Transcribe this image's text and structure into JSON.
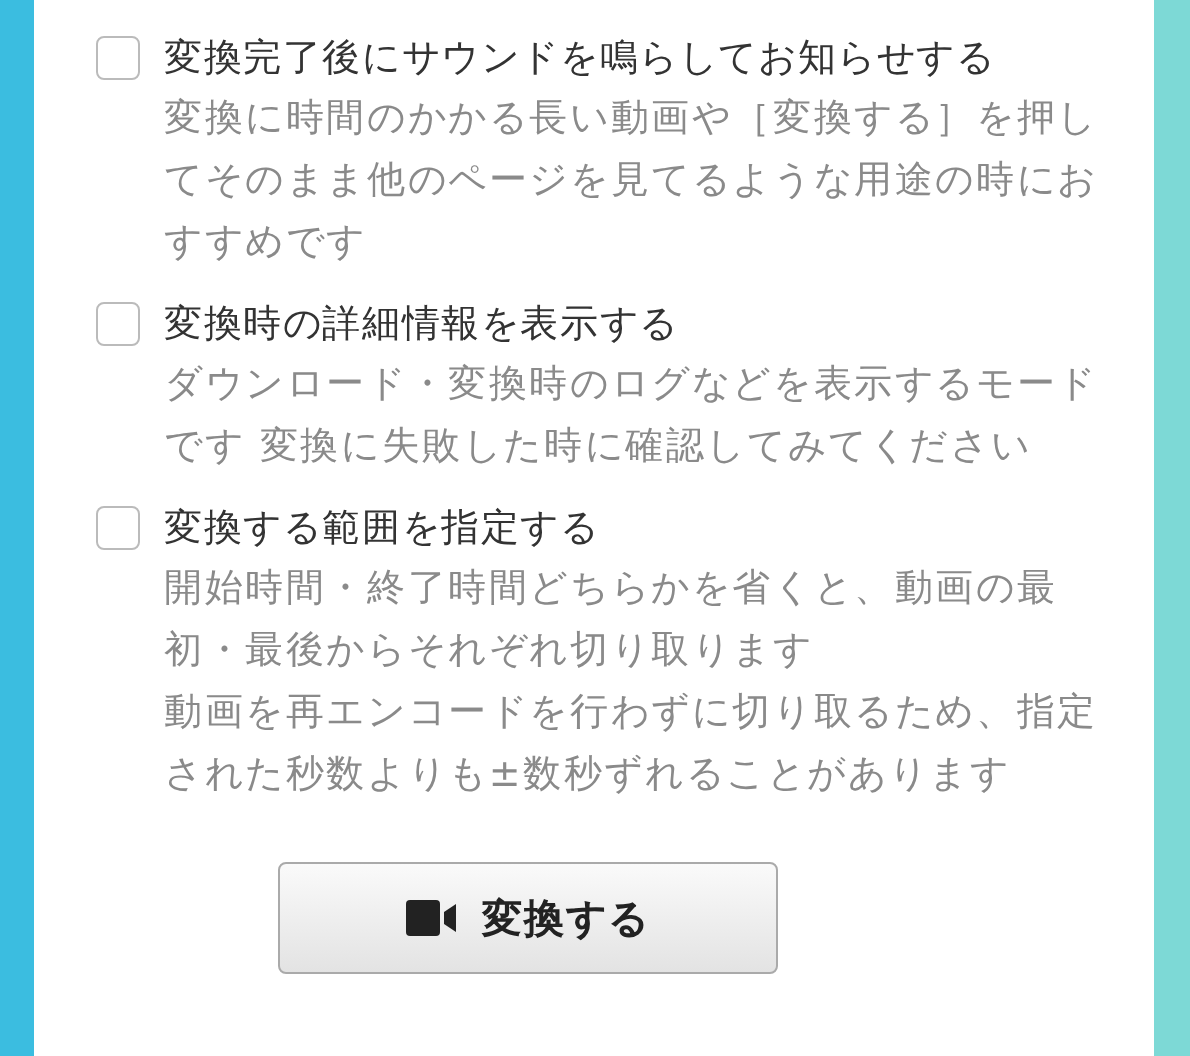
{
  "options": [
    {
      "label": "変換完了後にサウンドを鳴らしてお知らせする",
      "checked": false,
      "description": [
        "変換に時間のかかる長い動画や［変換する］を押してそのまま他のページを見てるような用途の時におすすめです"
      ]
    },
    {
      "label": "変換時の詳細情報を表示する",
      "checked": false,
      "description": [
        "ダウンロード・変換時のログなどを表示するモードです 変換に失敗した時に確認してみてください"
      ]
    },
    {
      "label": "変換する範囲を指定する",
      "checked": false,
      "description": [
        "開始時間・終了時間どちらかを省くと、動画の最初・最後からそれぞれ切り取ります",
        "動画を再エンコードを行わずに切り取るため、指定された秒数よりも±数秒ずれることがあります"
      ]
    }
  ],
  "convert_button": {
    "label": "変換する"
  }
}
